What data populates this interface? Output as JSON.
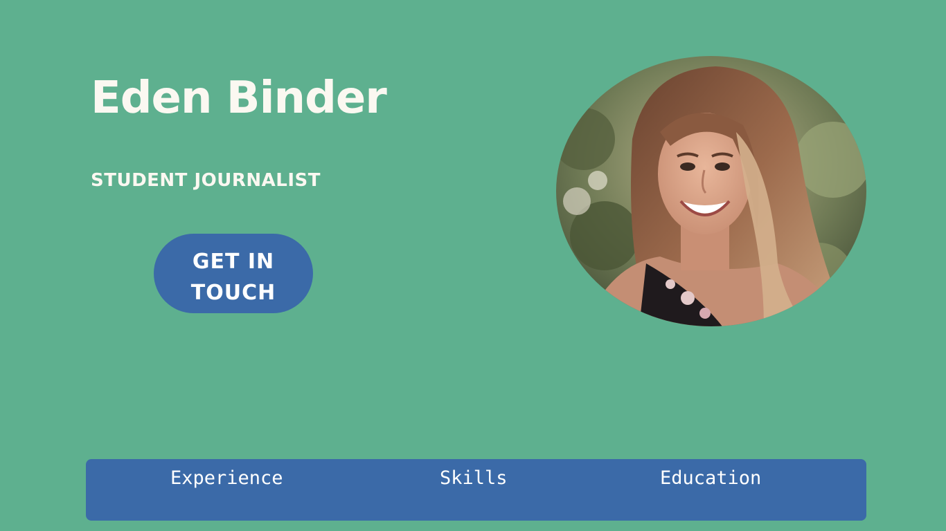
{
  "hero": {
    "name": "Eden Binder",
    "role": "STUDENT JOURNALIST",
    "cta_label": "GET IN TOUCH"
  },
  "profile_photo": {
    "description_icon": "portrait-photo"
  },
  "nav": {
    "items": [
      {
        "label": "Experience"
      },
      {
        "label": "Skills"
      },
      {
        "label": "Education"
      }
    ]
  },
  "colors": {
    "background": "#5eb08f",
    "accent": "#3b6aa8",
    "heading_text": "#fbf8f1"
  }
}
